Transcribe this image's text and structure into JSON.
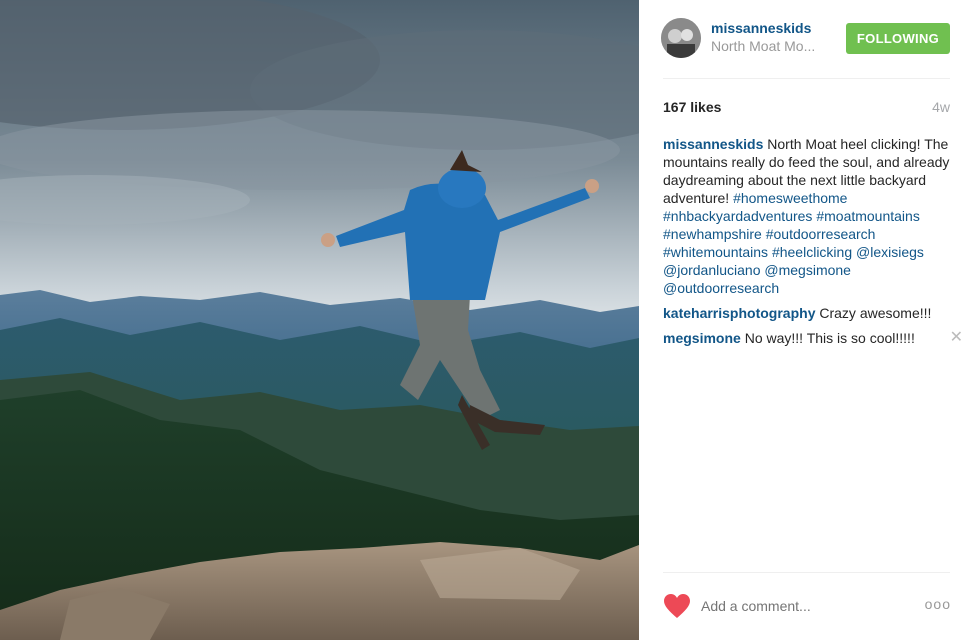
{
  "post": {
    "photo_icon": "jumping-hiker-mountains-photo",
    "header": {
      "username": "missanneskids",
      "location": "North Moat Mo...",
      "follow_label": "FOLLOWING",
      "follow_color": "#70c050"
    },
    "likes": "167 likes",
    "age": "4w",
    "caption": {
      "author": "missanneskids",
      "text": " North Moat heel clicking! The mountains really do feed the soul, and already daydreaming about the next little backyard adventure! ",
      "tags": [
        "#homesweethome",
        "#nhbackyardadventures",
        "#moatmountains",
        "#newhampshire",
        "#outdoorresearch",
        "#whitemountains",
        "#heelclicking",
        "@lexisiegs",
        "@jordanluciano",
        "@megsimone",
        "@outdoorresearch"
      ]
    },
    "comments": [
      {
        "author": "kateharrisphotography",
        "text": " Crazy awesome!!!"
      },
      {
        "author": "megsimone",
        "text": " No way!!! This is so cool!!!!!",
        "delete_icon": "close-icon"
      }
    ],
    "footer": {
      "like_icon": "heart-icon",
      "like_color": "#ed4956",
      "comment_placeholder": "Add a comment...",
      "more_label": "ooo"
    },
    "link_color": "#125688"
  }
}
